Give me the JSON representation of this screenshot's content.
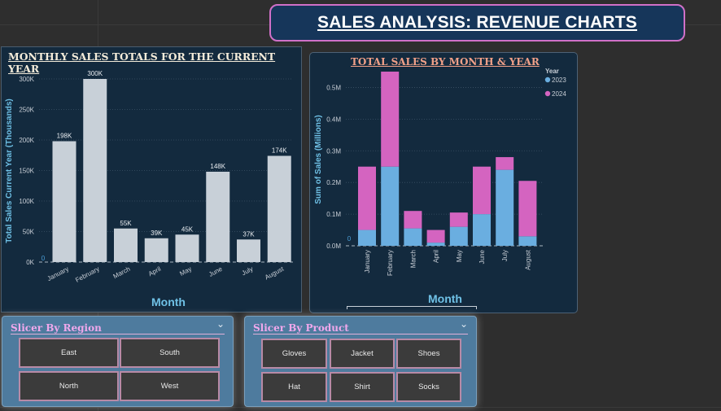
{
  "report_title": "SALES ANALYSIS: REVENUE CHARTS",
  "colors": {
    "background": "#2e2e2e",
    "panel": "#132a3e",
    "bar_current_year": "#c8d0d8",
    "series_2023": "#6aaee0",
    "series_2024": "#d464c0",
    "axis_title": "#6fc1e6",
    "slicer_bg": "#4e7b9e",
    "slicer_title": "#f0a8ec"
  },
  "icons": {
    "slicer_dropdown": "chevron-down-icon"
  },
  "chart_data": [
    {
      "type": "bar",
      "title": "MONTHLY SALES TOTALS FOR THE CURRENT YEAR",
      "xlabel": "Month",
      "ylabel": "Total Sales Current Year (Thousands)",
      "categories": [
        "January",
        "February",
        "March",
        "April",
        "May",
        "June",
        "July",
        "August"
      ],
      "values": [
        198,
        300,
        55,
        39,
        45,
        148,
        37,
        174
      ],
      "data_labels": [
        "198K",
        "300K",
        "55K",
        "39K",
        "45K",
        "148K",
        "37K",
        "174K"
      ],
      "ylim": [
        0,
        300
      ],
      "yticks": [
        0,
        50,
        100,
        150,
        200,
        250,
        300
      ],
      "ytick_labels": [
        "0K",
        "50K",
        "100K",
        "150K",
        "200K",
        "250K",
        "300K"
      ],
      "baseline_label": "0",
      "grid": true
    },
    {
      "type": "bar",
      "stacked": true,
      "title": "TOTAL SALES BY MONTH & YEAR",
      "xlabel": "Month",
      "ylabel": "Sum of Sales (Millions)",
      "categories": [
        "January",
        "February",
        "March",
        "April",
        "May",
        "June",
        "July",
        "August"
      ],
      "series": [
        {
          "name": "2023",
          "values": [
            0.05,
            0.25,
            0.055,
            0.01,
            0.06,
            0.1,
            0.24,
            0.03
          ]
        },
        {
          "name": "2024",
          "values": [
            0.2,
            0.3,
            0.055,
            0.04,
            0.045,
            0.15,
            0.04,
            0.175
          ]
        }
      ],
      "ylim": [
        0,
        0.55
      ],
      "yticks": [
        0,
        0.1,
        0.2,
        0.3,
        0.4,
        0.5
      ],
      "ytick_labels": [
        "0.0M",
        "0.1M",
        "0.2M",
        "0.3M",
        "0.4M",
        "0.5M"
      ],
      "legend_title": "Year",
      "legend_position": "top-right",
      "baseline_label": "0",
      "grid": true
    }
  ],
  "slicers": {
    "region": {
      "title": "Slicer By Region",
      "options": [
        "East",
        "South",
        "North",
        "West"
      ]
    },
    "product": {
      "title": "Slicer By Product",
      "options": [
        "Gloves",
        "Jacket",
        "Shoes",
        "Hat",
        "Shirt",
        "Socks"
      ]
    }
  }
}
